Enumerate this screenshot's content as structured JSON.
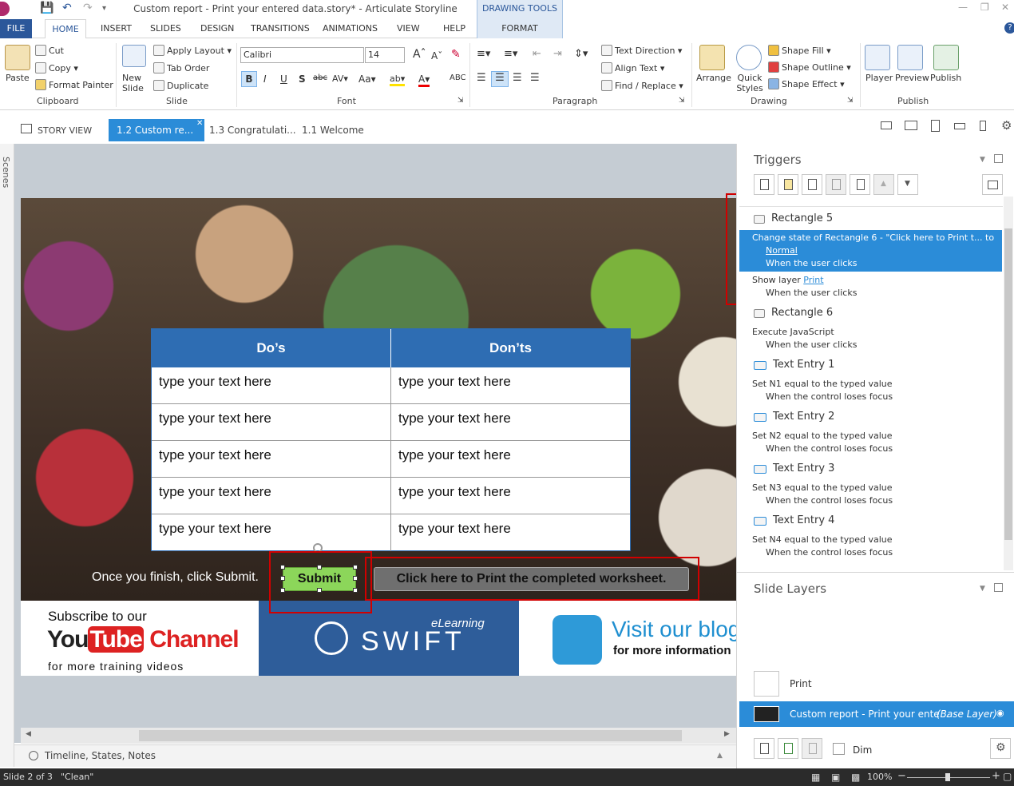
{
  "window": {
    "title": "Custom report - Print your entered data.story* - Articulate Storyline"
  },
  "drawing_tools": {
    "label": "DRAWING TOOLS",
    "tab": "FORMAT"
  },
  "menu": {
    "file": "FILE",
    "tabs": [
      "HOME",
      "INSERT",
      "SLIDES",
      "DESIGN",
      "TRANSITIONS",
      "ANIMATIONS",
      "VIEW",
      "HELP"
    ]
  },
  "ribbon": {
    "clipboard": {
      "paste": "Paste",
      "cut": "Cut",
      "copy": "Copy",
      "format_painter": "Format Painter",
      "label": "Clipboard"
    },
    "slide": {
      "new_slide": "New Slide",
      "apply_layout": "Apply Layout",
      "tab_order": "Tab Order",
      "duplicate": "Duplicate",
      "label": "Slide"
    },
    "font": {
      "family": "Calibri",
      "size": "14",
      "label": "Font"
    },
    "paragraph": {
      "text_direction": "Text Direction",
      "align_text": "Align Text",
      "find_replace": "Find / Replace",
      "label": "Paragraph"
    },
    "drawing": {
      "arrange": "Arrange",
      "quick_styles": "Quick Styles",
      "shape_fill": "Shape Fill",
      "shape_outline": "Shape Outline",
      "shape_effect": "Shape Effect",
      "label": "Drawing"
    },
    "publish": {
      "player": "Player",
      "preview": "Preview",
      "publish": "Publish",
      "label": "Publish"
    }
  },
  "doctabs": {
    "story_view": "STORY VIEW",
    "active": "1.2 Custom re...",
    "tab2": "1.3 Congratulati...",
    "tab3": "1.1 Welcome"
  },
  "scenes_label": "Scenes",
  "slide": {
    "table": {
      "headers": [
        "Do’s",
        "Don’ts"
      ],
      "rows": [
        [
          "type your text here",
          "type your text here"
        ],
        [
          "type your text here",
          "type your text here"
        ],
        [
          "type your text here",
          "type your text here"
        ],
        [
          "type your text here",
          "type your text here"
        ],
        [
          "type your text here",
          "type your text here"
        ]
      ]
    },
    "finish_text": "Once you finish, click Submit.",
    "submit": "Submit",
    "print_button": "Click here to Print the completed worksheet.",
    "banner": {
      "yt_line1": "Subscribe to our",
      "yt_you": "You",
      "yt_tube": "Tube",
      "yt_channel": "Channel",
      "yt_line3": "for more training videos",
      "swift_small": "eLearning",
      "swift": "SWIFT",
      "blog_line1": "Visit our blog",
      "blog_line2": "for more information"
    }
  },
  "timeline_label": "Timeline, States, Notes",
  "status": {
    "slide": "Slide 2 of 3",
    "clean": "\"Clean\"",
    "zoom": "100%"
  },
  "triggers": {
    "title": "Triggers",
    "items": [
      {
        "obj": "Rectangle 5"
      },
      {
        "line1": "Change state of Rectangle 6 - \"Click here to Print t... to",
        "link": "Normal",
        "when": "When the user clicks"
      },
      {
        "line1": "Show layer ",
        "link": "Print",
        "when": "When the user clicks"
      },
      {
        "obj": "Rectangle 6"
      },
      {
        "line1": "Execute JavaScript",
        "when": "When the user clicks"
      },
      {
        "obj": "Text Entry 1"
      },
      {
        "line1": "Set N1 equal to the typed value",
        "when": "When the control loses focus"
      },
      {
        "obj": "Text Entry 2"
      },
      {
        "line1": "Set N2 equal to the typed value",
        "when": "When the control loses focus"
      },
      {
        "obj": "Text Entry 3"
      },
      {
        "line1": "Set N3 equal to the typed value",
        "when": "When the control loses focus"
      },
      {
        "obj": "Text Entry 4"
      },
      {
        "line1": "Set N4 equal to the typed value",
        "when": "When the control loses focus"
      }
    ]
  },
  "layers": {
    "title": "Slide Layers",
    "print": "Print",
    "base": "Custom report - Print your ente...",
    "base_tag": "(Base Layer)",
    "dim": "Dim"
  }
}
